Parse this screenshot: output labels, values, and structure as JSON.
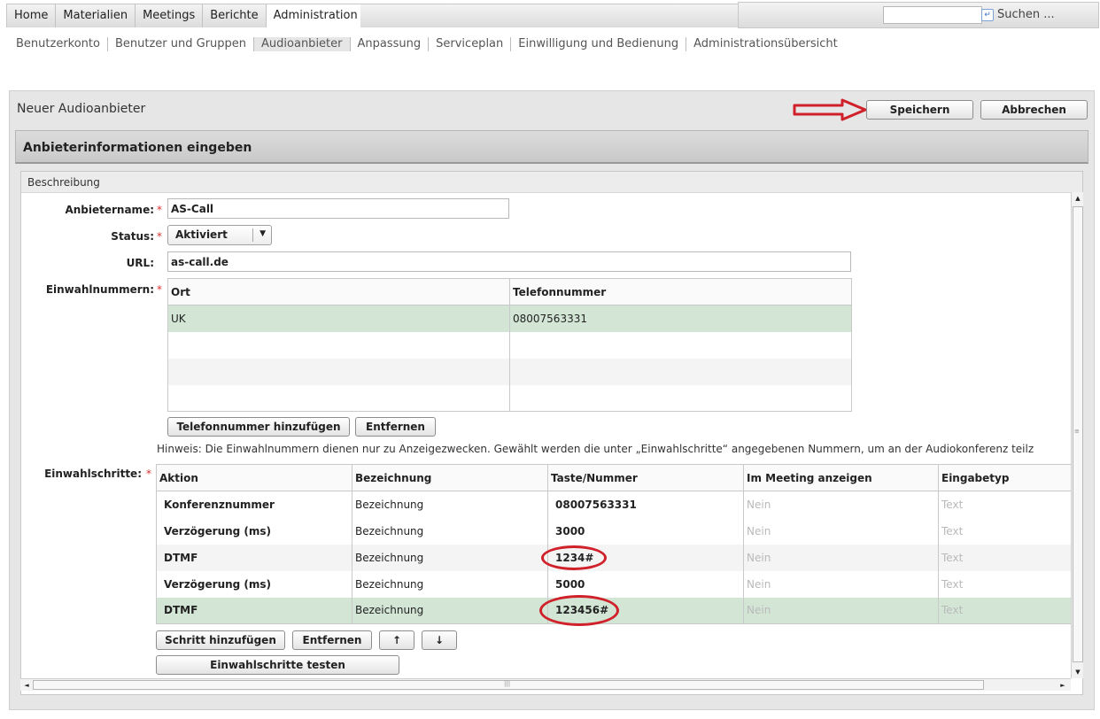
{
  "nav": {
    "tabs": [
      "Home",
      "Materialien",
      "Meetings",
      "Berichte",
      "Administration"
    ],
    "active_tab": "Administration",
    "search_label": "Suchen ...",
    "search_value": ""
  },
  "subnav": {
    "items": [
      "Benutzerkonto",
      "Benutzer und Gruppen",
      "Audioanbieter",
      "Anpassung",
      "Serviceplan",
      "Einwilligung und Bedienung",
      "Administrationsübersicht"
    ],
    "active": "Audioanbieter"
  },
  "page": {
    "title": "Neuer Audioanbieter",
    "save_label": "Speichern",
    "cancel_label": "Abbrechen",
    "section_title": "Anbieterinformationen eingeben",
    "subsection_title": "Beschreibung"
  },
  "form": {
    "provider_name_label": "Anbietername:",
    "provider_name": "AS-Call",
    "status_label": "Status:",
    "status_value": "Aktiviert",
    "url_label": "URL:",
    "url_value": "as-call.de",
    "dialin_label": "Einwahlnummern:",
    "dialin_columns": [
      "Ort",
      "Telefonnummer"
    ],
    "dialin_rows": [
      {
        "ort": "UK",
        "nummer": "08007563331"
      },
      {
        "ort": "",
        "nummer": ""
      },
      {
        "ort": "",
        "nummer": ""
      },
      {
        "ort": "",
        "nummer": ""
      }
    ],
    "add_number_label": "Telefonnummer hinzufügen",
    "remove_label": "Entfernen",
    "hint": "Hinweis: Die Einwahlnummern dienen nur zu Anzeigezwecken. Gewählt werden die unter „Einwahlschritte“ angegebenen Nummern, um an der Audiokonferenz teilz",
    "steps_label": "Einwahlschritte:",
    "steps_columns": [
      "Aktion",
      "Bezeichnung",
      "Taste/Nummer",
      "Im Meeting anzeigen",
      "Eingabetyp"
    ],
    "steps_rows": [
      {
        "aktion": "Konferenznummer",
        "bezeichnung": "Bezeichnung",
        "taste": "08007563331",
        "anzeigen": "Nein",
        "typ": "Text"
      },
      {
        "aktion": "Verzögerung (ms)",
        "bezeichnung": "Bezeichnung",
        "taste": "3000",
        "anzeigen": "Nein",
        "typ": "Text"
      },
      {
        "aktion": "DTMF",
        "bezeichnung": "Bezeichnung",
        "taste": "1234#",
        "anzeigen": "Nein",
        "typ": "Text"
      },
      {
        "aktion": "Verzögerung (ms)",
        "bezeichnung": "Bezeichnung",
        "taste": "5000",
        "anzeigen": "Nein",
        "typ": "Text"
      },
      {
        "aktion": "DTMF",
        "bezeichnung": "Bezeichnung",
        "taste": "123456#",
        "anzeigen": "Nein",
        "typ": "Text"
      }
    ],
    "add_step_label": "Schritt hinzufügen",
    "remove_step_label": "Entfernen",
    "move_up_label": "↑",
    "move_down_label": "↓",
    "test_steps_label": "Einwahlschritte testen",
    "required_mark": "*"
  },
  "colors": {
    "selected_row": "#d3e6d6",
    "annotation_red": "#d0202a"
  }
}
